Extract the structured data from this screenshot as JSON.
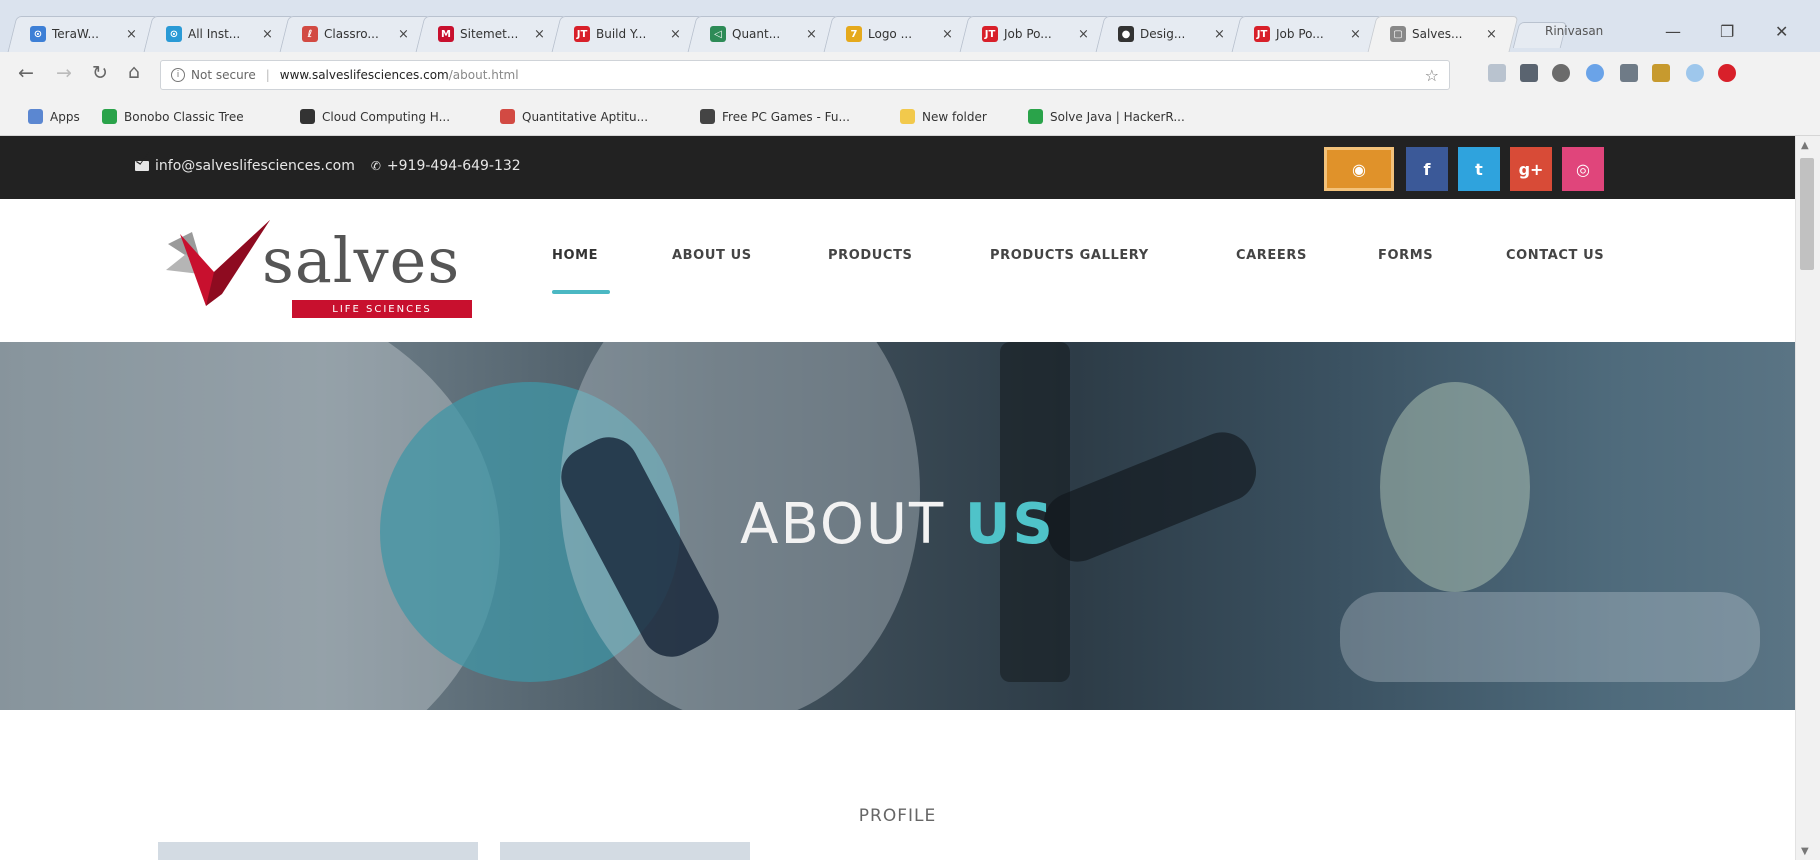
{
  "browser": {
    "tabs": [
      {
        "label": "TeraW...",
        "favicon_color": "#3d7fd6",
        "favicon_glyph": "⊙"
      },
      {
        "label": "All Inst...",
        "favicon_color": "#2a9ad6",
        "favicon_glyph": "⊙"
      },
      {
        "label": "Classro...",
        "favicon_color": "#d24a43",
        "favicon_glyph": "ℓ"
      },
      {
        "label": "Sitemet...",
        "favicon_color": "#c8102e",
        "favicon_glyph": "M"
      },
      {
        "label": "Build Y...",
        "favicon_color": "#d8202a",
        "favicon_glyph": "JT"
      },
      {
        "label": "Quant...",
        "favicon_color": "#2d8b57",
        "favicon_glyph": "◁"
      },
      {
        "label": "Logo ...",
        "favicon_color": "#e5a91c",
        "favicon_glyph": "7"
      },
      {
        "label": "Job Po...",
        "favicon_color": "#d8202a",
        "favicon_glyph": "JT"
      },
      {
        "label": "Desig...",
        "favicon_color": "#333333",
        "favicon_glyph": "●"
      },
      {
        "label": "Job Po...",
        "favicon_color": "#d8202a",
        "favicon_glyph": "JT"
      },
      {
        "label": "Salves...",
        "favicon_color": "#888888",
        "favicon_glyph": "▢"
      }
    ],
    "active_tab": 10,
    "window_user": "Rinivasan",
    "url_security": "Not secure",
    "url_host": "www.salveslifesciences.com",
    "url_path": "/about.html",
    "bookmarks": [
      {
        "label": "Apps",
        "color": "#5b87d1"
      },
      {
        "label": "Bonobo Classic Tree",
        "color": "#2aa34a"
      },
      {
        "label": "Cloud Computing H...",
        "color": "#333333"
      },
      {
        "label": "Quantitative Aptitu...",
        "color": "#d24a43"
      },
      {
        "label": "Free PC Games - Fu...",
        "color": "#444444"
      },
      {
        "label": "New folder",
        "color": "#f2c94c"
      },
      {
        "label": "Solve Java | HackerR...",
        "color": "#2aa34a"
      }
    ]
  },
  "topbar": {
    "email": "info@salveslifesciences.com",
    "phone": "+919-494-649-132",
    "social": [
      {
        "name": "badge",
        "glyph": "◉",
        "color": "#e0922a"
      },
      {
        "name": "facebook",
        "glyph": "f",
        "color": "#3b5998"
      },
      {
        "name": "twitter",
        "glyph": "t",
        "color": "#2fa3dd"
      },
      {
        "name": "google-plus",
        "glyph": "g+",
        "color": "#d84b37"
      },
      {
        "name": "instagram",
        "glyph": "◎",
        "color": "#e0457b"
      }
    ]
  },
  "logo": {
    "word": "salves",
    "tagline": "LIFE SCIENCES",
    "colors": {
      "red": "#c8102e",
      "grey": "#6c6c6c"
    }
  },
  "nav": {
    "items": [
      "HOME",
      "ABOUT US",
      "PRODUCTS",
      "PRODUCTS GALLERY",
      "CAREERS",
      "FORMS",
      "CONTACT US"
    ],
    "active": "HOME",
    "accent_color": "#4bb8c3"
  },
  "hero": {
    "title_main": "ABOUT ",
    "title_accent": "US"
  },
  "section": {
    "label": "PROFILE"
  }
}
